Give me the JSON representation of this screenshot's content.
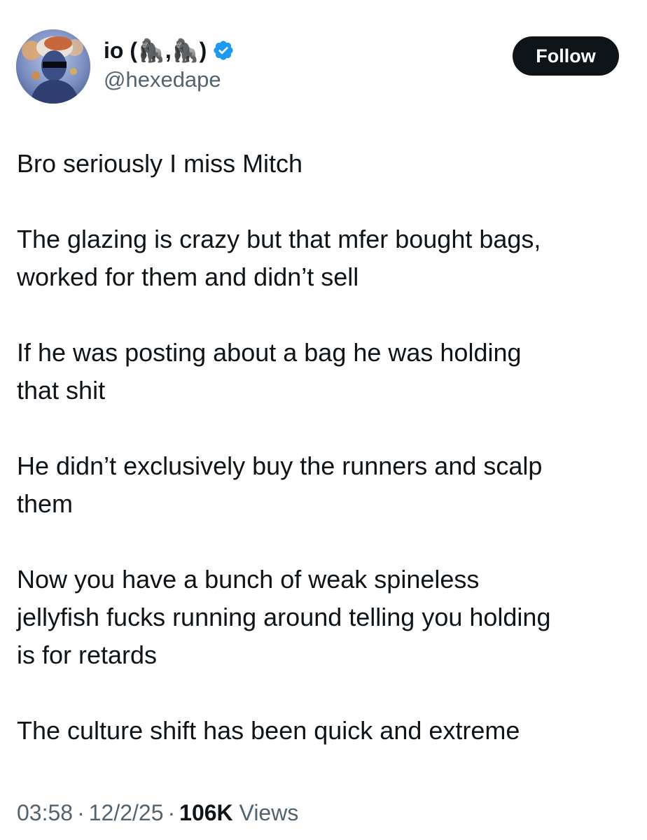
{
  "author": {
    "display_name": "io (🦍,🦍)",
    "handle": "@hexedape",
    "verified": true,
    "verified_icon": "verified-badge-icon",
    "avatar_icon": "profile-avatar"
  },
  "follow_button": {
    "label": "Follow"
  },
  "tweet": {
    "paragraphs": [
      "Bro seriously I miss Mitch",
      "The glazing is crazy but that mfer bought bags,\nworked for them and didn’t sell",
      "If he was posting about a bag he was holding\nthat shit",
      "He didn’t exclusively buy the runners and scalp\nthem",
      "Now you have a bunch of weak spineless\njellyfish fucks running around telling you holding\nis for retards",
      "The culture shift has been quick and extreme"
    ]
  },
  "meta": {
    "time": "03:58",
    "date": "12/2/25",
    "views_count": "106K",
    "views_label": "Views",
    "separator": "·"
  },
  "colors": {
    "text": "#0f1419",
    "secondary_text": "#536471",
    "verified_blue": "#1d9bf0",
    "follow_bg": "#0f1419",
    "follow_text": "#ffffff"
  }
}
